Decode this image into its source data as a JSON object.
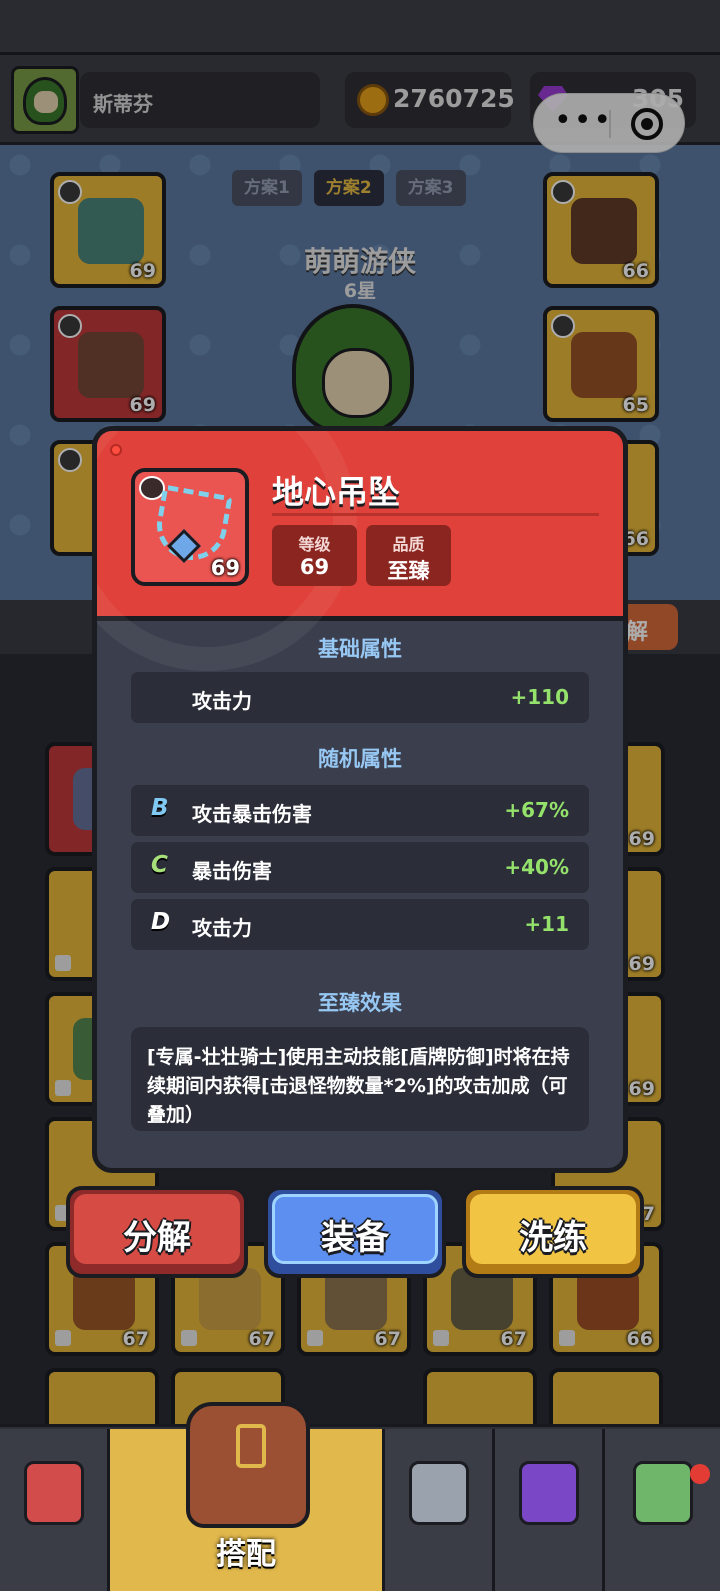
{
  "hud": {
    "player_name": "斯蒂芬",
    "gold": "2760725",
    "gems": "305"
  },
  "plan_tabs": [
    "方案1",
    "方案2",
    "方案3"
  ],
  "active_plan": "方案2",
  "hero": {
    "name": "萌萌游侠",
    "stars": "6星"
  },
  "equip_slots": {
    "left": [
      {
        "level": "69"
      },
      {
        "level": "69"
      }
    ],
    "right": [
      {
        "level": "66"
      },
      {
        "level": "65"
      },
      {
        "level": "66"
      }
    ]
  },
  "background_button": "解",
  "inventory_levels": {
    "right_col": [
      "69",
      "69",
      "69",
      "7"
    ],
    "row5": [
      "67",
      "67",
      "67",
      "67",
      "66"
    ]
  },
  "item": {
    "name": "地心吊坠",
    "level": "69",
    "level_label": "等级",
    "quality_label": "品质",
    "quality": "至臻",
    "color_quality": "#e0413a"
  },
  "basic": {
    "title": "基础属性",
    "stats": [
      {
        "name": "攻击力",
        "value": "+110"
      }
    ]
  },
  "random": {
    "title": "随机属性",
    "stats": [
      {
        "tier": "B",
        "name": "攻击暴击伤害",
        "value": "+67%",
        "tier_color": "#7fc9f2"
      },
      {
        "tier": "C",
        "name": "暴击伤害",
        "value": "+40%",
        "tier_color": "#a7e07a"
      },
      {
        "tier": "D",
        "name": "攻击力",
        "value": "+11",
        "tier_color": "#ffffff"
      }
    ]
  },
  "effect": {
    "title": "至臻效果",
    "text": "[专属-壮壮骑士]使用主动技能[盾牌防御]时将在持续期间内获得[击退怪物数量*2%]的攻击加成（可叠加）"
  },
  "actions": {
    "decompose": "分解",
    "equip": "装备",
    "reforge": "洗练"
  },
  "nav": {
    "items": [
      "shop-icon",
      "bag-icon",
      "battle-icon",
      "book-icon",
      "map-icon"
    ],
    "active_label": "搭配"
  }
}
